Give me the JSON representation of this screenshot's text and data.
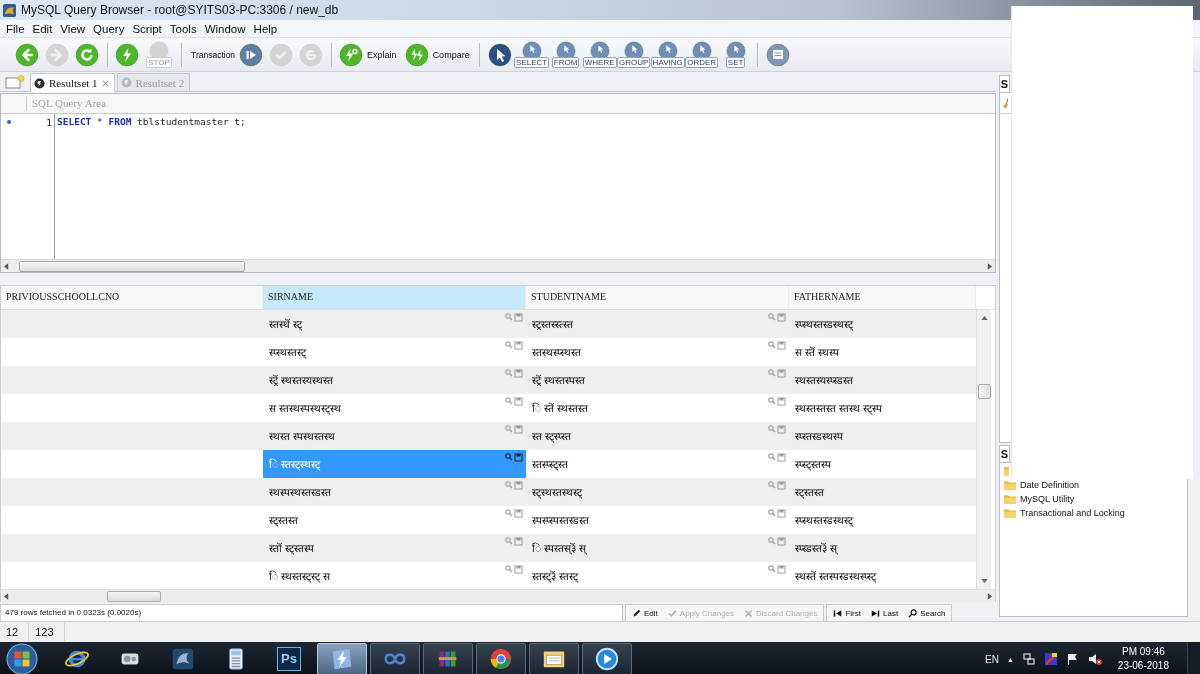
{
  "window": {
    "title": "MySQL Query Browser - root@SYITS03-PC:3306 / new_db"
  },
  "menu": [
    "File",
    "Edit",
    "View",
    "Query",
    "Script",
    "Tools",
    "Window",
    "Help"
  ],
  "toolbar": {
    "groups": [
      [
        {
          "kind": "icon",
          "disabled": false
        },
        {
          "kind": "icon",
          "disabled": true
        },
        {
          "kind": "icon",
          "disabled": false
        }
      ],
      [
        {
          "kind": "icon",
          "disabled": false
        },
        {
          "kind": "captioned",
          "label": "STOP",
          "disabled": true
        }
      ],
      [
        {
          "kind": "text",
          "label": "Transaction"
        },
        {
          "kind": "icon",
          "disabled": false
        },
        {
          "kind": "icon",
          "disabled": true
        },
        {
          "kind": "icon",
          "disabled": true
        }
      ],
      [
        {
          "kind": "labeled",
          "label": "Explain",
          "disabled": false
        },
        {
          "kind": "labeled",
          "label": "Compare",
          "disabled": false
        }
      ],
      [
        {
          "kind": "icon",
          "disabled": false
        },
        {
          "kind": "captioned",
          "label": "SELECT",
          "disabled": false
        },
        {
          "kind": "captioned",
          "label": "FROM",
          "disabled": false
        },
        {
          "kind": "captioned",
          "label": "WHERE",
          "disabled": false
        },
        {
          "kind": "captioned",
          "label": "GROUP",
          "disabled": false
        },
        {
          "kind": "captioned",
          "label": "HAVING",
          "disabled": false
        },
        {
          "kind": "captioned",
          "label": "ORDER",
          "disabled": false
        },
        {
          "kind": "captioned",
          "label": "SET",
          "disabled": false
        }
      ],
      [
        {
          "kind": "icon",
          "disabled": false
        }
      ]
    ]
  },
  "tabs": [
    {
      "label": "Resultset 1",
      "selected": true,
      "closable": true
    },
    {
      "label": "Resultset 2",
      "selected": false,
      "closable": false
    }
  ],
  "query": {
    "header": "SQL Query Area",
    "lines": [
      {
        "number": "1",
        "current": true,
        "tokens": [
          {
            "kind": "keyword",
            "text": "SELECT"
          },
          {
            "kind": "plain",
            "text": " * "
          },
          {
            "kind": "keyword",
            "text": "FROM"
          },
          {
            "kind": "plain",
            "text": " tblstudentmaster t;"
          }
        ]
      }
    ]
  },
  "grid": {
    "columns": [
      {
        "label": "PRIVIOUSSCHOOLLCNO",
        "selected": false
      },
      {
        "label": "SIRNAME",
        "selected": true
      },
      {
        "label": "STUDENTNAME",
        "selected": false
      },
      {
        "label": "FATHERNAME",
        "selected": false
      }
    ],
    "rows": [
      {
        "cells": [
          {
            "text": "",
            "selected": false
          },
          {
            "text": "स्तस्थॆं स्ट्",
            "selected": false
          },
          {
            "text": "स्ट्रस्तस्स्त्स्त",
            "selected": false
          },
          {
            "text": "स्प्स्थस्तस्डस्थस्ट्",
            "selected": false
          }
        ]
      },
      {
        "cells": [
          {
            "text": "",
            "selected": false
          },
          {
            "text": "स्प्स्थस्तस्ट्",
            "selected": false
          },
          {
            "text": "स्तस्थस्प्स्थस्त",
            "selected": false
          },
          {
            "text": "स स्तॆं स्थस्प",
            "selected": false
          }
        ]
      },
      {
        "cells": [
          {
            "text": "",
            "selected": false
          },
          {
            "text": "स्ट्रॆं स्थस्तस्यस्थस्त",
            "selected": false
          },
          {
            "text": "स्ट्रॆं स्थस्तस्पस्त",
            "selected": false
          },
          {
            "text": "स्थस्तस्यस्प्स्डस्त",
            "selected": false
          }
        ]
      },
      {
        "cells": [
          {
            "text": "",
            "selected": false
          },
          {
            "text": "स स्तस्थस्पस्थस्ट्स्थ",
            "selected": false
          },
          {
            "text": "ि स्तॆं स्थस्तस्त",
            "selected": false
          },
          {
            "text": "स्थस्तस्तस्त स्तस्थ स्ट्स्प",
            "selected": false
          }
        ]
      },
      {
        "cells": [
          {
            "text": "",
            "selected": false
          },
          {
            "text": "स्थस्त स्पस्थस्तस्थ",
            "selected": false
          },
          {
            "text": "स्त स्ट्स्प्स्त",
            "selected": false
          },
          {
            "text": "स्प्स्तस्डस्थस्प",
            "selected": false
          }
        ]
      },
      {
        "cells": [
          {
            "text": "",
            "selected": false
          },
          {
            "text": "ि स्तस्ट्स्थस्ट्",
            "selected": true
          },
          {
            "text": "स्तस्प्स्ट्स्त",
            "selected": false
          },
          {
            "text": "स्प्स्ट्स्तस्प",
            "selected": false
          }
        ]
      },
      {
        "cells": [
          {
            "text": "",
            "selected": false
          },
          {
            "text": "स्थस्पस्थस्तस्डस्त",
            "selected": false
          },
          {
            "text": "स्ट्स्थस्तस्थस्ट्",
            "selected": false
          },
          {
            "text": "स्ट्स्तस्त",
            "selected": false
          }
        ]
      },
      {
        "cells": [
          {
            "text": "",
            "selected": false
          },
          {
            "text": "स्ट्स्तस्त",
            "selected": false
          },
          {
            "text": "स्पस्प्स्पस्तस्डस्त",
            "selected": false
          },
          {
            "text": "स्प्स्थस्तस्डस्थस्ट्",
            "selected": false
          }
        ]
      },
      {
        "cells": [
          {
            "text": "",
            "selected": false
          },
          {
            "text": "स्तॊं स्ट्स्तस्प",
            "selected": false
          },
          {
            "text": "ि स्पस्तस्३ॆं स्",
            "selected": false
          },
          {
            "text": "स्प्स्डस्त३ॆं स्",
            "selected": false
          }
        ]
      },
      {
        "cells": [
          {
            "text": "",
            "selected": false
          },
          {
            "text": "ि स्थस्तस्ट्स्ट् स",
            "selected": false
          },
          {
            "text": "स्तस्ट्३ॆं स्तस्ट्",
            "selected": false
          },
          {
            "text": "स्थस्तॆं स्तस्पस्डस्थस्प्स्ट्",
            "selected": false
          }
        ]
      }
    ]
  },
  "status": {
    "message": "479 rows fetched in 0.0323s (0.0020s)",
    "edit_actions": [
      {
        "label": "Edit",
        "disabled": false
      },
      {
        "label": "Apply Changes",
        "disabled": true
      },
      {
        "label": "Discard Changes",
        "disabled": true
      }
    ],
    "navigation": [
      "First",
      "Last",
      "Search"
    ]
  },
  "status_bar": [
    "12",
    "123"
  ],
  "sidebar": {
    "panels": [
      {
        "tab": "S",
        "kind": "tools"
      },
      {
        "tab": "S",
        "kind": "tree",
        "items": [
          {
            "kind": "folder"
          },
          {
            "kind": "folder",
            "label": "Date Definition"
          },
          {
            "kind": "folder",
            "label": "MySQL Utility"
          },
          {
            "kind": "folder",
            "label": "Transactional and Locking"
          }
        ]
      }
    ]
  },
  "taskbar": {
    "apps": [
      {
        "running": false,
        "selected": false
      },
      {
        "running": false,
        "selected": false
      },
      {
        "running": false,
        "selected": false
      },
      {
        "running": false,
        "selected": false
      },
      {
        "running": false,
        "selected": false,
        "label": "Ps"
      },
      {
        "running": true,
        "selected": true
      },
      {
        "running": true,
        "selected": false
      },
      {
        "running": true,
        "selected": false
      },
      {
        "running": true,
        "selected": false
      },
      {
        "running": true,
        "selected": false
      },
      {
        "running": true,
        "selected": false
      }
    ],
    "tray": {
      "language": "EN",
      "expander": "▲",
      "time": "PM 09:46",
      "date": "23-06-2018"
    }
  }
}
